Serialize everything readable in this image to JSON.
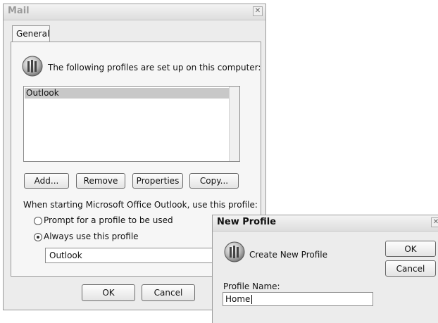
{
  "mail_dialog": {
    "title": "Mail",
    "close_symbol": "✕",
    "tab_label": "General",
    "profiles_heading": "The following profiles are set up on this computer:",
    "profiles": [
      "Outlook"
    ],
    "buttons": {
      "add": "Add...",
      "remove": "Remove",
      "properties": "Properties",
      "copy": "Copy..."
    },
    "startup_label": "When starting Microsoft Office Outlook, use this profile:",
    "radio_prompt": "Prompt for a profile to be used",
    "radio_always": "Always use this profile",
    "selected_radio": "always",
    "default_profile": "Outlook",
    "ok_label": "OK",
    "cancel_label": "Cancel"
  },
  "new_profile_dialog": {
    "title": "New Profile",
    "close_symbol": "✕",
    "header_text": "Create New Profile",
    "ok_label": "OK",
    "cancel_label": "Cancel",
    "profile_name_label": "Profile Name:",
    "profile_name_value": "Home"
  },
  "icons": {
    "profile_icon": "outlook-profile-icon"
  }
}
